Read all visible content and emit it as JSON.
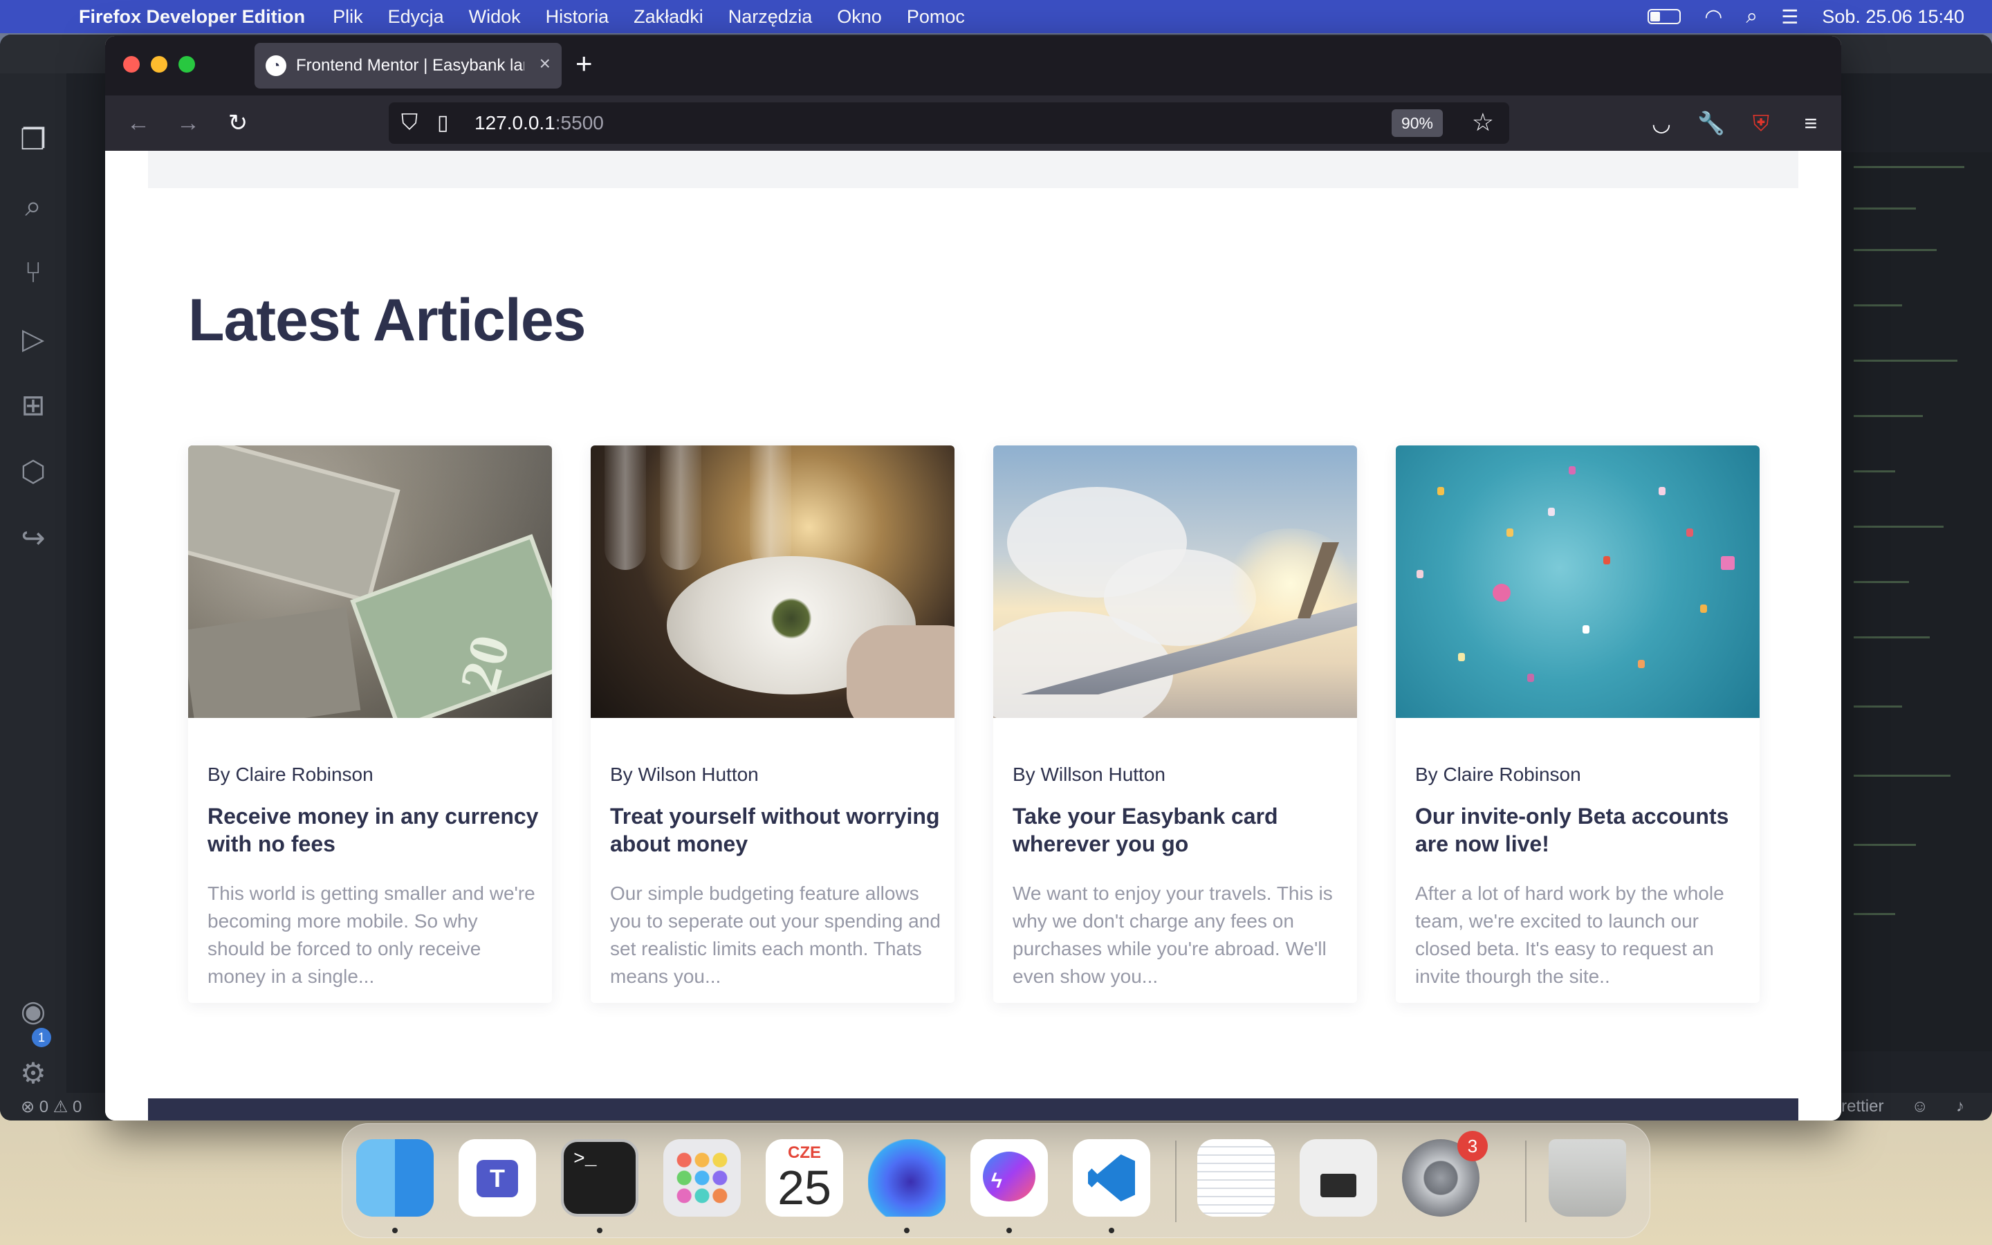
{
  "menubar": {
    "app_name": "Firefox Developer Edition",
    "menus": [
      "Plik",
      "Edycja",
      "Widok",
      "Historia",
      "Zakładki",
      "Narzędzia",
      "Okno",
      "Pomoc"
    ],
    "datetime": "Sob. 25.06  15:40"
  },
  "vscode": {
    "status_problems": "⊗ 0  ⚠ 0",
    "status_prettier": "rettier",
    "account_badge": "1"
  },
  "browser": {
    "tab_title": "Frontend Mentor | Easybank landing page",
    "url_host": "127.0.0.1",
    "url_port": ":5500",
    "zoom": "90%"
  },
  "page": {
    "section_title": "Latest Articles",
    "articles": [
      {
        "author": "By Claire Robinson",
        "title": "Receive money in any currency with no fees",
        "excerpt": "This world is getting smaller and we're becoming more mobile. So why should be forced to only receive money in a single...",
        "image": "currency-banknotes"
      },
      {
        "author": "By Wilson Hutton",
        "title": "Treat yourself without worrying about money",
        "excerpt": "Our simple budgeting feature allows you to seperate out your spending and set realistic limits each month. Thats means you...",
        "image": "restaurant-dinner"
      },
      {
        "author": "By Willson Hutton",
        "title": "Take your Easybank card wherever you go",
        "excerpt": "We want to enjoy your travels. This is why we don't charge any fees on purchases while you're abroad. We'll even show you...",
        "image": "airplane-wing"
      },
      {
        "author": "By Claire Robinson",
        "title": "Our invite-only Beta accounts are now live!",
        "excerpt": "After a lot of hard work by the whole team, we're excited to launch our closed beta. It's easy to request an invite thourgh the site..",
        "image": "confetti"
      }
    ]
  },
  "dock": {
    "calendar_month": "CZE",
    "calendar_day": "25",
    "settings_badge": "3",
    "apps": [
      "Finder",
      "Microsoft Teams",
      "Terminal",
      "Launchpad",
      "Calendar",
      "Firefox Developer Edition",
      "Messenger",
      "Visual Studio Code",
      "TextEdit",
      "System Information",
      "System Preferences",
      "Trash"
    ]
  },
  "colors": {
    "heading": "#2d314d",
    "body_text": "#9698a6",
    "footer": "#2d314d",
    "menubar": "#3b4fc2"
  }
}
